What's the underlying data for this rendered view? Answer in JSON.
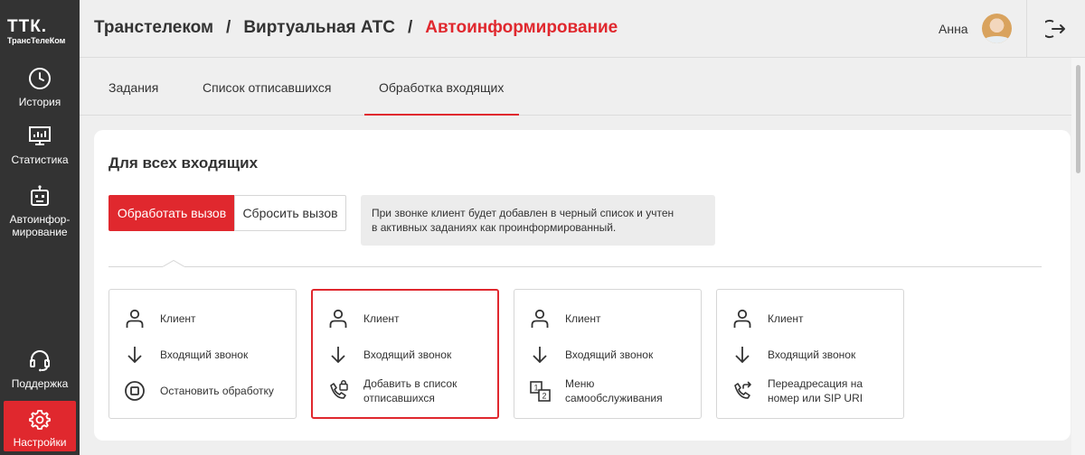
{
  "sidebar": {
    "logo_main": "ТТК.",
    "logo_sub": "ТрансТелеКом",
    "items": [
      {
        "label": "История",
        "icon": "clock-icon"
      },
      {
        "label": "Статистика",
        "icon": "monitor-chart-icon"
      },
      {
        "label": "Автоинфор-мирование",
        "label_line1": "Автоинфор-",
        "label_line2": "мирование",
        "icon": "robot-icon"
      },
      {
        "label": "Поддержка",
        "icon": "headset-icon"
      },
      {
        "label": "Настройки",
        "icon": "gear-icon",
        "active": true
      }
    ]
  },
  "header": {
    "breadcrumbs": [
      "Транстелеком",
      "Виртуальная АТС",
      "Автоинформирование"
    ],
    "separator": "/",
    "user_name": "Анна"
  },
  "tabs": {
    "items": [
      "Задания",
      "Список отписавшихся",
      "Обработка входящих"
    ],
    "active_index": 2
  },
  "main": {
    "title": "Для всех входящих",
    "buttons": {
      "process": "Обработать вызов",
      "reset": "Сбросить вызов"
    },
    "hint_line1": "При звонке клиент будет добавлен в черный список и учтен",
    "hint_line2": "в активных заданиях как проинформированный.",
    "options": [
      {
        "rows": [
          {
            "icon": "person-icon",
            "text": "Клиент"
          },
          {
            "icon": "arrow-down-icon",
            "text": "Входящий звонок"
          },
          {
            "icon": "stop-icon",
            "text": "Остановить обработку"
          }
        ]
      },
      {
        "selected": true,
        "rows": [
          {
            "icon": "person-icon",
            "text": "Клиент"
          },
          {
            "icon": "arrow-down-icon",
            "text": "Входящий звонок"
          },
          {
            "icon": "phone-lock-icon",
            "text": "Добавить в список",
            "text2": "отписавшихся"
          }
        ]
      },
      {
        "rows": [
          {
            "icon": "person-icon",
            "text": "Клиент"
          },
          {
            "icon": "arrow-down-icon",
            "text": "Входящий звонок"
          },
          {
            "icon": "menu-numbers-icon",
            "text": "Меню",
            "text2": "самообслуживания"
          }
        ]
      },
      {
        "rows": [
          {
            "icon": "person-icon",
            "text": "Клиент"
          },
          {
            "icon": "arrow-down-icon",
            "text": "Входящий звонок"
          },
          {
            "icon": "phone-forward-icon",
            "text": "Переадресация на",
            "text2": "номер или SIP URI"
          }
        ]
      }
    ]
  },
  "colors": {
    "accent": "#e0282e",
    "sidebar_bg": "#333333",
    "page_bg": "#efefef"
  }
}
